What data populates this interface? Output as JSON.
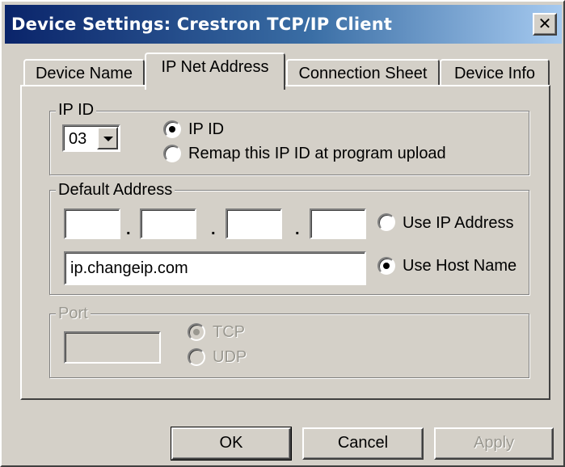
{
  "window": {
    "title": "Device Settings: Crestron TCP/IP Client",
    "close_glyph": "✕"
  },
  "tabs": [
    {
      "label": "Device Name",
      "active": false
    },
    {
      "label": "IP Net Address",
      "active": true
    },
    {
      "label": "Connection Sheet",
      "active": false
    },
    {
      "label": "Device Info",
      "active": false
    }
  ],
  "ip_id_group": {
    "legend": "IP ID",
    "selected_value": "03",
    "options": [
      {
        "label": "IP ID",
        "checked": true
      },
      {
        "label": "Remap this IP ID at program upload",
        "checked": false
      }
    ]
  },
  "default_address_group": {
    "legend": "Default Address",
    "octets": [
      "",
      "",
      "",
      ""
    ],
    "separator": ".",
    "host_name": "ip.changeip.com",
    "options": [
      {
        "label": "Use IP Address",
        "checked": false
      },
      {
        "label": "Use Host Name",
        "checked": true
      }
    ]
  },
  "port_group": {
    "legend": "Port",
    "port_value": "",
    "enabled": false,
    "options": [
      {
        "label": "TCP",
        "checked": true
      },
      {
        "label": "UDP",
        "checked": false
      }
    ]
  },
  "buttons": {
    "ok": "OK",
    "cancel": "Cancel",
    "apply": "Apply",
    "apply_enabled": false
  },
  "colors": {
    "face": "#d4d0c8",
    "title_gradient_start": "#0a246a",
    "title_gradient_end": "#a6caf0",
    "disabled_text": "#9a9890"
  }
}
